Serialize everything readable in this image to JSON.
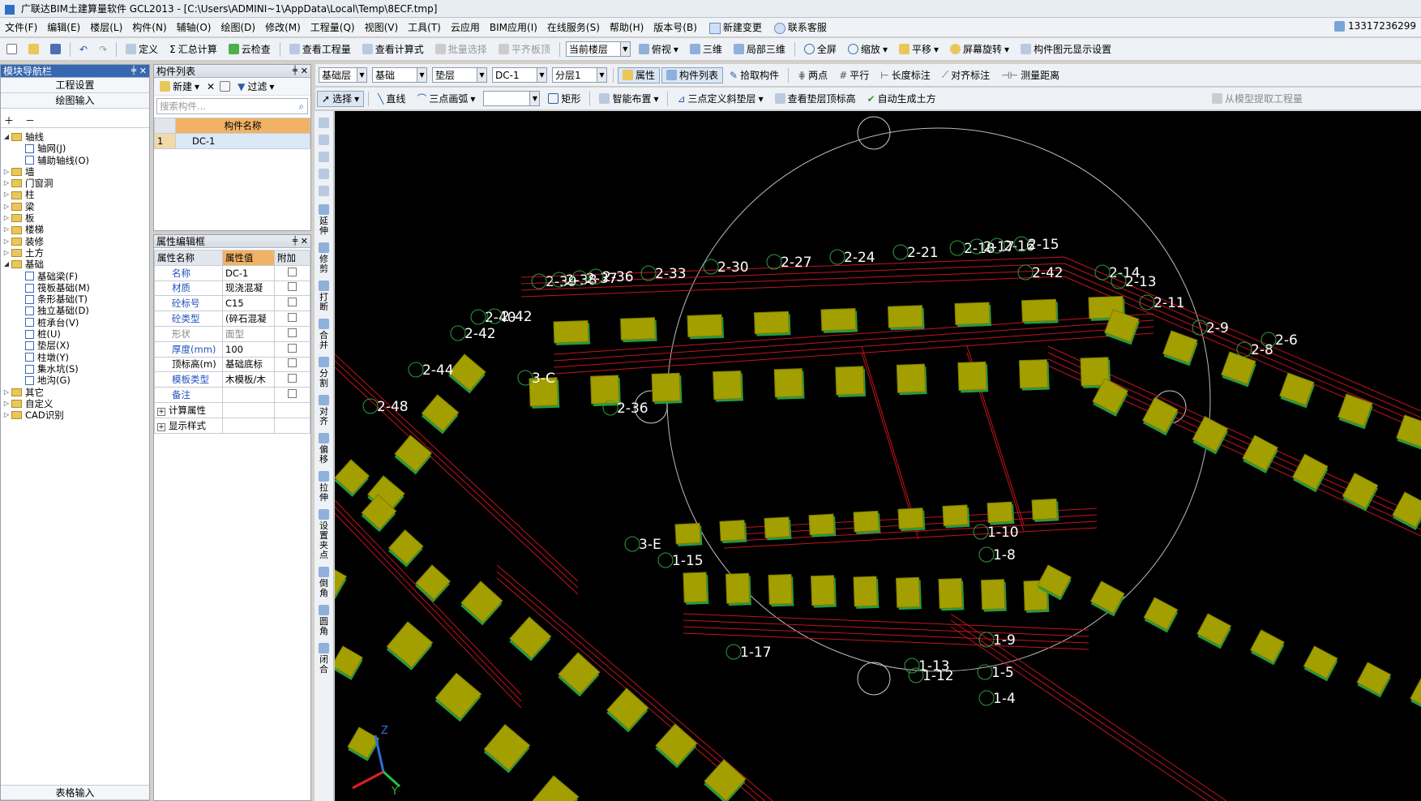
{
  "window": {
    "title": "广联达BIM土建算量软件 GCL2013 - [C:\\Users\\ADMINI~1\\AppData\\Local\\Temp\\8ECF.tmp]"
  },
  "menu": {
    "items": [
      "文件(F)",
      "编辑(E)",
      "楼层(L)",
      "构件(N)",
      "辅轴(O)",
      "绘图(D)",
      "修改(M)",
      "工程量(Q)",
      "视图(V)",
      "工具(T)",
      "云应用",
      "BIM应用(I)",
      "在线服务(S)",
      "帮助(H)",
      "版本号(B)"
    ],
    "change": "新建变更",
    "support": "联系客服",
    "user": "13317236299"
  },
  "toolbar1": {
    "define": "定义",
    "calc": "汇总计算",
    "cloud_check": "云检查",
    "view_qty": "查看工程量",
    "view_formula": "查看计算式",
    "batch_select": "批量选择",
    "flat_board": "平齐板顶",
    "current_floor": "当前楼层",
    "topview": "俯视",
    "three_d": "三维",
    "local_3d": "局部三维",
    "fullscreen": "全屏",
    "zoom": "缩放",
    "pan": "平移",
    "rotate": "屏幕旋转",
    "display_settings": "构件图元显示设置"
  },
  "toolbar2": {
    "layer": "基础层",
    "category": "基础",
    "type": "垫层",
    "component": "DC-1",
    "sublayer": "分层1",
    "attribute": "属性",
    "component_list": "构件列表",
    "pick": "拾取构件",
    "two_points": "两点",
    "parallel": "平行",
    "length_mark": "长度标注",
    "align_mark": "对齐标注",
    "measure": "测量距离"
  },
  "toolbar3": {
    "select": "选择",
    "line": "直线",
    "arc": "三点画弧",
    "rect": "矩形",
    "smart": "智能布置",
    "slope_def": "三点定义斜垫层",
    "view_top": "查看垫层顶标高",
    "auto_soil": "自动生成土方",
    "extract": "从模型提取工程量"
  },
  "nav": {
    "title": "模块导航栏",
    "project_settings": "工程设置",
    "draw_input": "绘图输入",
    "table_input": "表格输入",
    "tree": [
      {
        "label": "轴线",
        "level": 0,
        "type": "folder",
        "expanded": true
      },
      {
        "label": "轴网(J)",
        "level": 1,
        "type": "leaf"
      },
      {
        "label": "辅助轴线(O)",
        "level": 1,
        "type": "leaf"
      },
      {
        "label": "墙",
        "level": 0,
        "type": "folder"
      },
      {
        "label": "门窗洞",
        "level": 0,
        "type": "folder"
      },
      {
        "label": "柱",
        "level": 0,
        "type": "folder"
      },
      {
        "label": "梁",
        "level": 0,
        "type": "folder"
      },
      {
        "label": "板",
        "level": 0,
        "type": "folder"
      },
      {
        "label": "楼梯",
        "level": 0,
        "type": "folder"
      },
      {
        "label": "装修",
        "level": 0,
        "type": "folder"
      },
      {
        "label": "土方",
        "level": 0,
        "type": "folder"
      },
      {
        "label": "基础",
        "level": 0,
        "type": "folder",
        "expanded": true
      },
      {
        "label": "基础梁(F)",
        "level": 1,
        "type": "leaf"
      },
      {
        "label": "筏板基础(M)",
        "level": 1,
        "type": "leaf"
      },
      {
        "label": "条形基础(T)",
        "level": 1,
        "type": "leaf"
      },
      {
        "label": "独立基础(D)",
        "level": 1,
        "type": "leaf"
      },
      {
        "label": "桩承台(V)",
        "level": 1,
        "type": "leaf"
      },
      {
        "label": "桩(U)",
        "level": 1,
        "type": "leaf"
      },
      {
        "label": "垫层(X)",
        "level": 1,
        "type": "leaf"
      },
      {
        "label": "柱墩(Y)",
        "level": 1,
        "type": "leaf"
      },
      {
        "label": "集水坑(S)",
        "level": 1,
        "type": "leaf"
      },
      {
        "label": "地沟(G)",
        "level": 1,
        "type": "leaf"
      },
      {
        "label": "其它",
        "level": 0,
        "type": "folder"
      },
      {
        "label": "自定义",
        "level": 0,
        "type": "folder"
      },
      {
        "label": "CAD识别",
        "level": 0,
        "type": "folder"
      }
    ]
  },
  "component_list": {
    "title": "构件列表",
    "new": "新建",
    "filter": "过滤",
    "search_placeholder": "搜索构件...",
    "col_name": "构件名称",
    "rows": [
      {
        "idx": "1",
        "name": "DC-1"
      }
    ]
  },
  "props": {
    "title": "属性编辑框",
    "headers": [
      "属性名称",
      "属性值",
      "附加"
    ],
    "rows": [
      {
        "name": "名称",
        "value": "DC-1",
        "style": "blue",
        "check": false
      },
      {
        "name": "材质",
        "value": "现浇混凝",
        "style": "blue",
        "check": true
      },
      {
        "name": "砼标号",
        "value": "C15",
        "style": "blue",
        "check": true
      },
      {
        "name": "砼类型",
        "value": "(碎石混凝",
        "style": "blue",
        "check": true
      },
      {
        "name": "形状",
        "value": "面型",
        "style": "gray",
        "check": true
      },
      {
        "name": "厚度(mm)",
        "value": "100",
        "style": "blue",
        "check": true
      },
      {
        "name": "顶标高(m)",
        "value": "基础底标",
        "style": "black",
        "check": true
      },
      {
        "name": "模板类型",
        "value": "木模板/木",
        "style": "blue",
        "check": true
      },
      {
        "name": "备注",
        "value": "",
        "style": "blue",
        "check": true
      },
      {
        "name": "计算属性",
        "value": "",
        "style": "group",
        "check": null
      },
      {
        "name": "显示样式",
        "value": "",
        "style": "group",
        "check": null
      }
    ]
  },
  "vtools": [
    "延伸",
    "修剪",
    "打断",
    "合并",
    "分割",
    "对齐",
    "偏移",
    "拉伸",
    "设置夹点",
    "倒角",
    "圆角",
    "闭合"
  ],
  "canvas": {
    "labels": [
      "2-39",
      "2-38",
      "2-37",
      "2-36",
      "2-33",
      "2-30",
      "2-27",
      "2-24",
      "2-21",
      "2-18",
      "2-17",
      "2-16",
      "2-15",
      "2-42",
      "2-14",
      "2-13",
      "2-11",
      "2-9",
      "2-8",
      "2-6",
      "2-40",
      "2-42",
      "2-42",
      "2-44",
      "2-48",
      "2-36",
      "3-C",
      "3-E",
      "1-15",
      "1-10",
      "1-8",
      "1-9",
      "1-17",
      "1-13",
      "1-12",
      "1-5",
      "1-4"
    ]
  }
}
